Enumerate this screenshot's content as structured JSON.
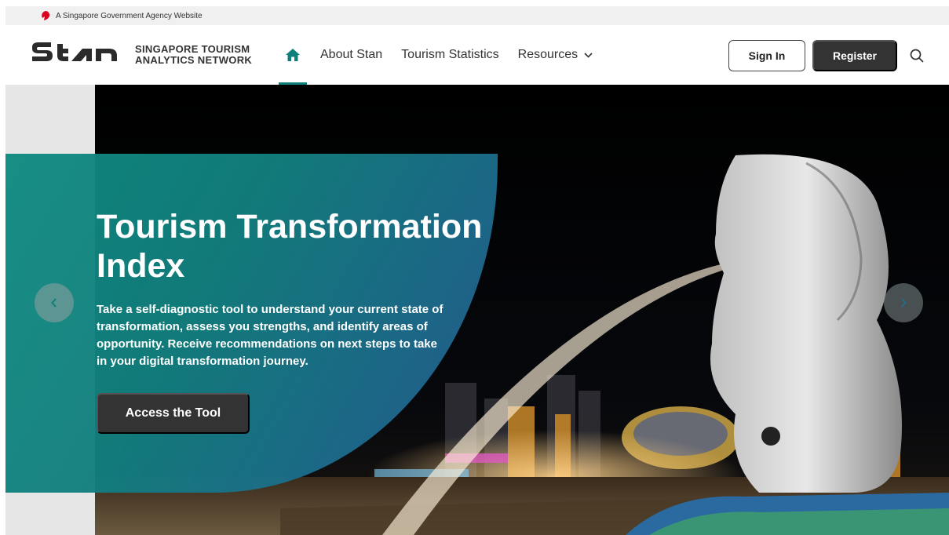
{
  "gov_banner": {
    "text": "A Singapore Government Agency Website"
  },
  "logo": {
    "line1": "SINGAPORE TOURISM",
    "line2": "ANALYTICS NETWORK"
  },
  "nav": {
    "items": [
      {
        "label": "About Stan"
      },
      {
        "label": "Tourism Statistics"
      },
      {
        "label": "Resources"
      }
    ]
  },
  "header": {
    "sign_in": "Sign In",
    "register": "Register"
  },
  "hero": {
    "title": "Tourism Transformation Index",
    "description": "Take a self-diagnostic tool to understand your current state of transformation, assess you strengths, and identify areas of opportunity. Receive recommendations on next steps to take in your digital transformation journey.",
    "button": "Access the Tool"
  },
  "colors": {
    "accent": "#0e7f79",
    "dark_button": "#333333",
    "panel_start": "#0e8a80",
    "panel_end": "#27598f"
  },
  "icons": [
    "lion-head-icon",
    "home-icon",
    "chevron-down-icon",
    "search-icon",
    "chevron-left-icon",
    "chevron-right-icon"
  ]
}
